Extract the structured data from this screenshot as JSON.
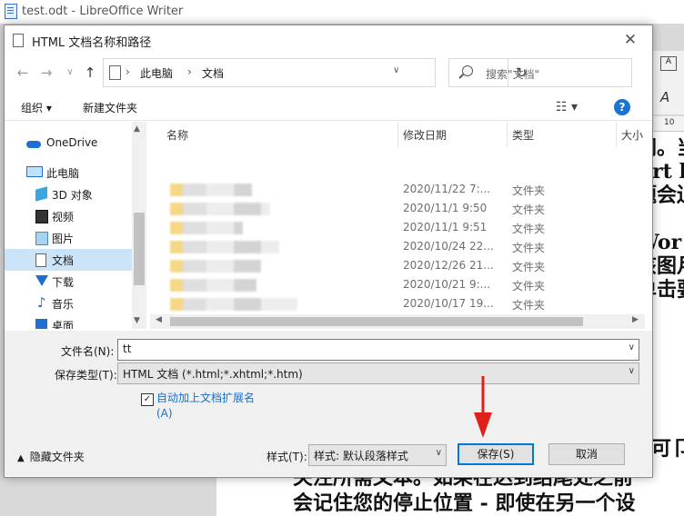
{
  "background_window": {
    "title": "test.odt - LibreOffice Writer",
    "ruler_tick": "10",
    "doc_right_lines": [
      "阔。当",
      "Art l",
      "题会迫",
      "",
      "Wor",
      "该图月",
      "单击要"
    ],
    "doc_right_line2": "可卩",
    "doc_bottom_lines": [
      "关注所需文本。如果在达到结尾处之前",
      "会记住您的停止位置 - 即使在另一个设"
    ]
  },
  "dialog": {
    "title": "HTML 文档名称和路径",
    "close_label": "✕",
    "nav": {
      "back": "←",
      "forward": "→",
      "dropdown": "∨",
      "up": "↑",
      "breadcrumb": [
        "此电脑",
        "文档"
      ],
      "breadcrumb_sep": "›",
      "refresh": "↻",
      "search_placeholder": "搜索\"文档\""
    },
    "toolbar": {
      "organize": "组织 ▾",
      "new_folder": "新建文件夹",
      "view_icon": "☷ ▾",
      "help": "?"
    },
    "sidebar": [
      {
        "label": "OneDrive",
        "icon": "cloud-icon"
      },
      {
        "label": "此电脑",
        "icon": "computer-icon"
      },
      {
        "label": "3D 对象",
        "icon": "3d-objects-icon"
      },
      {
        "label": "视频",
        "icon": "video-icon"
      },
      {
        "label": "图片",
        "icon": "pictures-icon"
      },
      {
        "label": "文档",
        "icon": "documents-icon",
        "selected": true
      },
      {
        "label": "下载",
        "icon": "download-icon"
      },
      {
        "label": "音乐",
        "icon": "music-icon"
      },
      {
        "label": "桌面",
        "icon": "desktop-icon"
      }
    ],
    "columns": [
      "名称",
      "修改日期",
      "类型",
      "大小"
    ],
    "rows": [
      {
        "date": "2020/11/22 7:...",
        "type": "文件夹"
      },
      {
        "date": "2020/11/1 9:50",
        "type": "文件夹"
      },
      {
        "date": "2020/11/1 9:51",
        "type": "文件夹"
      },
      {
        "date": "2020/10/24 22...",
        "type": "文件夹"
      },
      {
        "date": "2020/12/26 21...",
        "type": "文件夹"
      },
      {
        "date": "2020/10/21 9:...",
        "type": "文件夹"
      },
      {
        "date": "2020/10/17 19...",
        "type": "文件夹"
      }
    ],
    "filename_label": "文件名(N):",
    "filename_value": "tt",
    "filetype_label": "保存类型(T):",
    "filetype_value": "HTML 文档 (*.html;*.xhtml;*.htm)",
    "auto_ext_label_line1": "自动加上文档扩展名",
    "auto_ext_label_line2": "(A)",
    "auto_ext_checked": "✓",
    "hide_folders": "隐藏文件夹",
    "style_label": "样式(T):",
    "style_value": "样式: 默认段落样式",
    "save_button": "保存(S)",
    "cancel_button": "取消"
  }
}
